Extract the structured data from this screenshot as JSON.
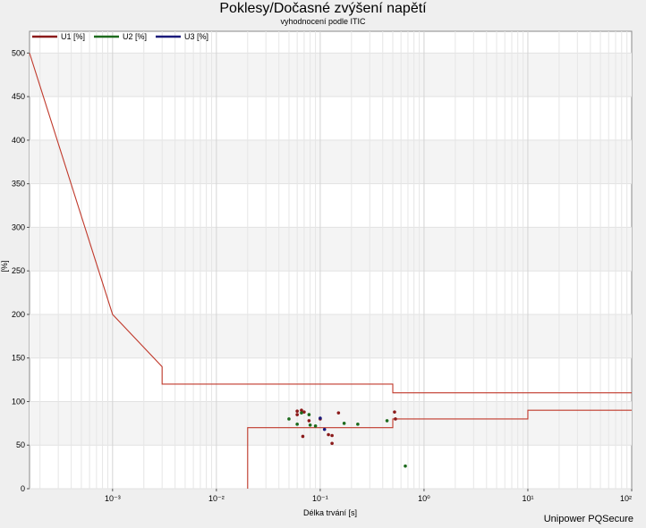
{
  "header": {
    "title": "Poklesy/Dočasné zvýšení napětí",
    "subtitle": "vyhodnocení podle ITIC"
  },
  "footer": {
    "brand": "Unipower PQSecure"
  },
  "chart_data": {
    "type": "scatter",
    "title": "Poklesy/Dočasné zvýšení napětí",
    "subtitle": "vyhodnocení podle ITIC",
    "xlabel": "Délka trvání [s]",
    "ylabel": "[%]",
    "x_scale": "log",
    "xlim": [
      0.0001585,
      100
    ],
    "ylim": [
      0,
      525
    ],
    "x_ticks": [
      {
        "value": 0.001,
        "label": "10⁻³"
      },
      {
        "value": 0.01,
        "label": "10⁻²"
      },
      {
        "value": 0.1,
        "label": "10⁻¹"
      },
      {
        "value": 1,
        "label": "10⁰"
      },
      {
        "value": 10,
        "label": "10¹"
      },
      {
        "value": 100,
        "label": "10²"
      }
    ],
    "y_ticks": [
      0,
      50,
      100,
      150,
      200,
      250,
      300,
      350,
      400,
      450,
      500
    ],
    "grid": true,
    "legend_position": "top-left",
    "legend": [
      {
        "name": "U1 [%]",
        "color": "#8b1a1a"
      },
      {
        "name": "U2 [%]",
        "color": "#1e6b1e"
      },
      {
        "name": "U3 [%]",
        "color": "#1a1a7a"
      }
    ],
    "limit_curves": {
      "color": "#c0392b",
      "upper": [
        [
          0.0001585,
          500
        ],
        [
          0.001,
          200
        ],
        [
          0.003,
          140
        ],
        [
          0.003,
          120
        ],
        [
          0.5,
          120
        ],
        [
          0.5,
          110
        ],
        [
          100,
          110
        ]
      ],
      "lower": [
        [
          0.02,
          0
        ],
        [
          0.02,
          70
        ],
        [
          0.5,
          70
        ],
        [
          0.5,
          80
        ],
        [
          10,
          80
        ],
        [
          10,
          90
        ],
        [
          100,
          90
        ]
      ]
    },
    "series": [
      {
        "name": "U1 [%]",
        "color": "#8b1a1a",
        "points": [
          [
            0.06,
            89
          ],
          [
            0.06,
            85
          ],
          [
            0.066,
            90
          ],
          [
            0.07,
            88
          ],
          [
            0.068,
            60
          ],
          [
            0.078,
            78
          ],
          [
            0.1,
            80
          ],
          [
            0.12,
            62
          ],
          [
            0.13,
            61
          ],
          [
            0.13,
            52
          ],
          [
            0.15,
            87
          ],
          [
            0.52,
            88
          ],
          [
            0.53,
            80
          ]
        ]
      },
      {
        "name": "U2 [%]",
        "color": "#1e6b1e",
        "points": [
          [
            0.05,
            80
          ],
          [
            0.06,
            74
          ],
          [
            0.066,
            87
          ],
          [
            0.078,
            85
          ],
          [
            0.08,
            73
          ],
          [
            0.09,
            72
          ],
          [
            0.17,
            75
          ],
          [
            0.23,
            74
          ],
          [
            0.44,
            78
          ],
          [
            0.66,
            26
          ]
        ]
      },
      {
        "name": "U3 [%]",
        "color": "#1a1a7a",
        "points": [
          [
            0.1,
            81
          ],
          [
            0.11,
            68
          ]
        ]
      }
    ]
  }
}
